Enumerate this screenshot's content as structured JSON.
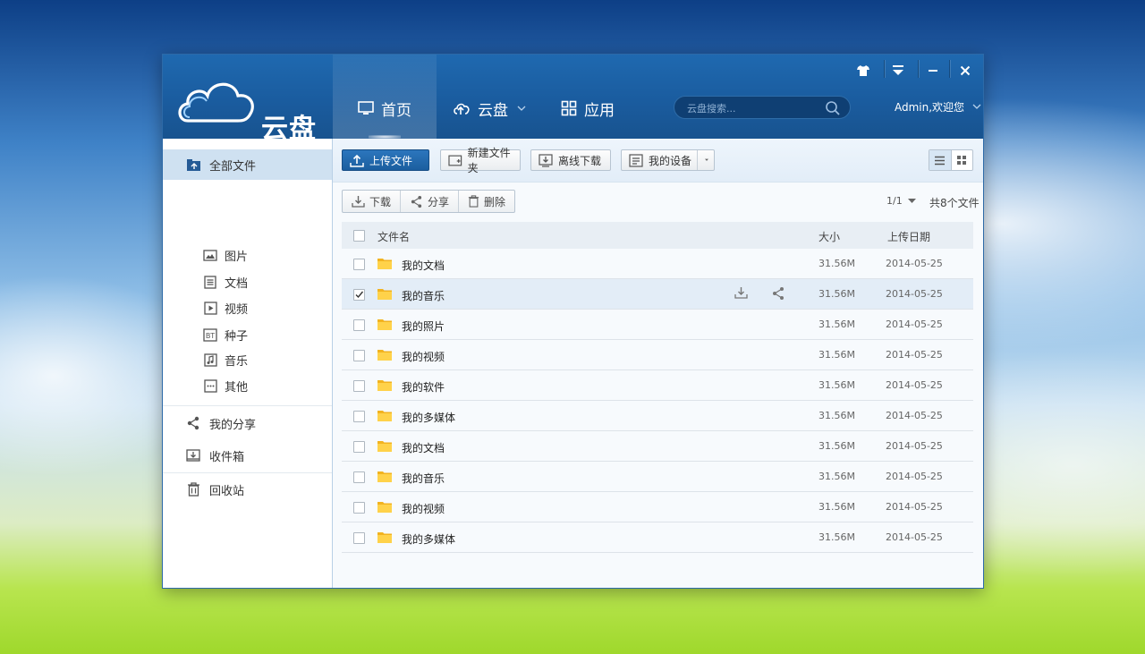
{
  "app": {
    "logo_text": "云盘",
    "nav": [
      {
        "label": "首页",
        "icon": "monitor-icon",
        "active": true
      },
      {
        "label": "云盘",
        "icon": "cloud-upload-icon",
        "active": false
      },
      {
        "label": "应用",
        "icon": "apps-grid-icon",
        "active": false
      }
    ],
    "search_placeholder": "云盘搜索...",
    "user_label": "Admin,欢迎您"
  },
  "sidebar": {
    "all_files": "全部文件",
    "categories": [
      {
        "label": "图片",
        "icon": "image-icon"
      },
      {
        "label": "文档",
        "icon": "document-icon"
      },
      {
        "label": "视频",
        "icon": "video-icon"
      },
      {
        "label": "种子",
        "icon": "bt-torrent-icon"
      },
      {
        "label": "音乐",
        "icon": "music-icon"
      },
      {
        "label": "其他",
        "icon": "more-icon"
      }
    ],
    "my_share": "我的分享",
    "inbox": "收件箱",
    "recycle": "回收站"
  },
  "toolbar": {
    "upload": "上传文件",
    "new_folder": "新建文件夹",
    "offline_download": "离线下载",
    "my_devices": "我的设备"
  },
  "actions": {
    "download": "下载",
    "share": "分享",
    "delete": "删除"
  },
  "pager": {
    "page": "1/1",
    "count_text": "共8个文件"
  },
  "table": {
    "headers": {
      "name": "文件名",
      "size": "大小",
      "date": "上传日期"
    },
    "rows": [
      {
        "name": "我的文档",
        "size": "31.56M",
        "date": "2014-05-25",
        "checked": false
      },
      {
        "name": "我的音乐",
        "size": "31.56M",
        "date": "2014-05-25",
        "checked": true
      },
      {
        "name": "我的照片",
        "size": "31.56M",
        "date": "2014-05-25",
        "checked": false
      },
      {
        "name": "我的视频",
        "size": "31.56M",
        "date": "2014-05-25",
        "checked": false
      },
      {
        "name": "我的软件",
        "size": "31.56M",
        "date": "2014-05-25",
        "checked": false
      },
      {
        "name": "我的多媒体",
        "size": "31.56M",
        "date": "2014-05-25",
        "checked": false
      },
      {
        "name": "我的文档",
        "size": "31.56M",
        "date": "2014-05-25",
        "checked": false
      },
      {
        "name": "我的音乐",
        "size": "31.56M",
        "date": "2014-05-25",
        "checked": false
      },
      {
        "name": "我的视频",
        "size": "31.56M",
        "date": "2014-05-25",
        "checked": false
      },
      {
        "name": "我的多媒体",
        "size": "31.56M",
        "date": "2014-05-25",
        "checked": false
      }
    ]
  }
}
